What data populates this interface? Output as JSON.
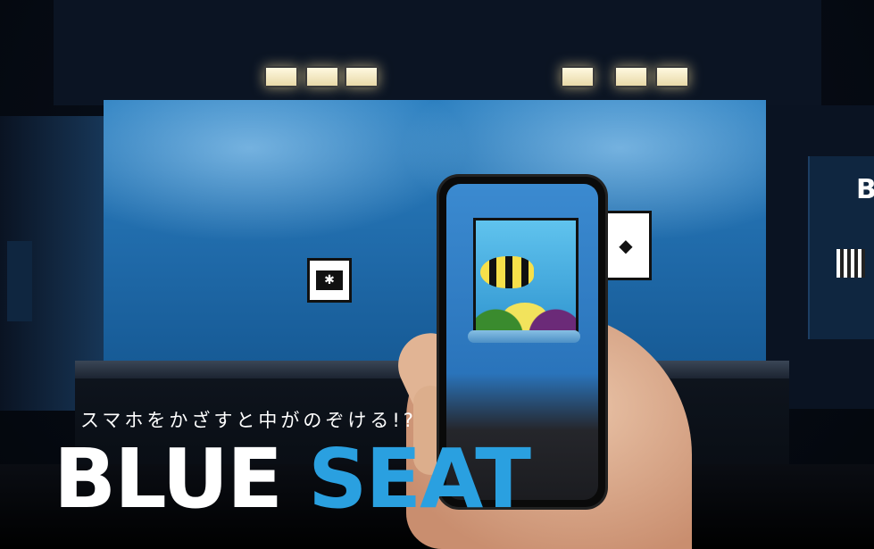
{
  "tagline": "スマホをかざすと中がのぞける!?",
  "logo": {
    "word1": "BLUE",
    "word2": "SEAT",
    "color_white": "#ffffff",
    "color_blue": "#2aa0e0"
  },
  "scene": {
    "right_panel_heading": "BL"
  }
}
